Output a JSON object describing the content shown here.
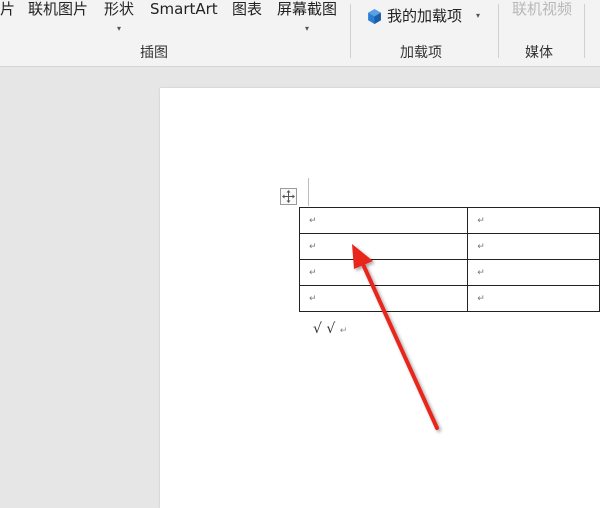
{
  "ribbon": {
    "buttons": {
      "pictures_partial": "片",
      "online_pictures": "联机图片",
      "shapes": "形状",
      "smartart": "SmartArt",
      "chart": "图表",
      "screenshot": "屏幕截图",
      "my_addins": "我的加载项",
      "online_video": "联机视频"
    },
    "groups": {
      "illustrations": "插图",
      "addins": "加载项",
      "media": "媒体"
    },
    "caret": "▾"
  },
  "document": {
    "table": {
      "rows": [
        [
          "↵",
          "↵"
        ],
        [
          "↵",
          "↵"
        ],
        [
          "↵",
          "↵"
        ],
        [
          "↵",
          "↵"
        ]
      ]
    },
    "below_text": "√ √",
    "paragraph_mark": "↵"
  },
  "colors": {
    "arrow": "#e8261f",
    "addin_icon": "#2b7cd3"
  },
  "icons": {
    "move_handle": "move-arrows-icon",
    "addin": "store-cube-icon",
    "annotation": "red-arrow"
  }
}
